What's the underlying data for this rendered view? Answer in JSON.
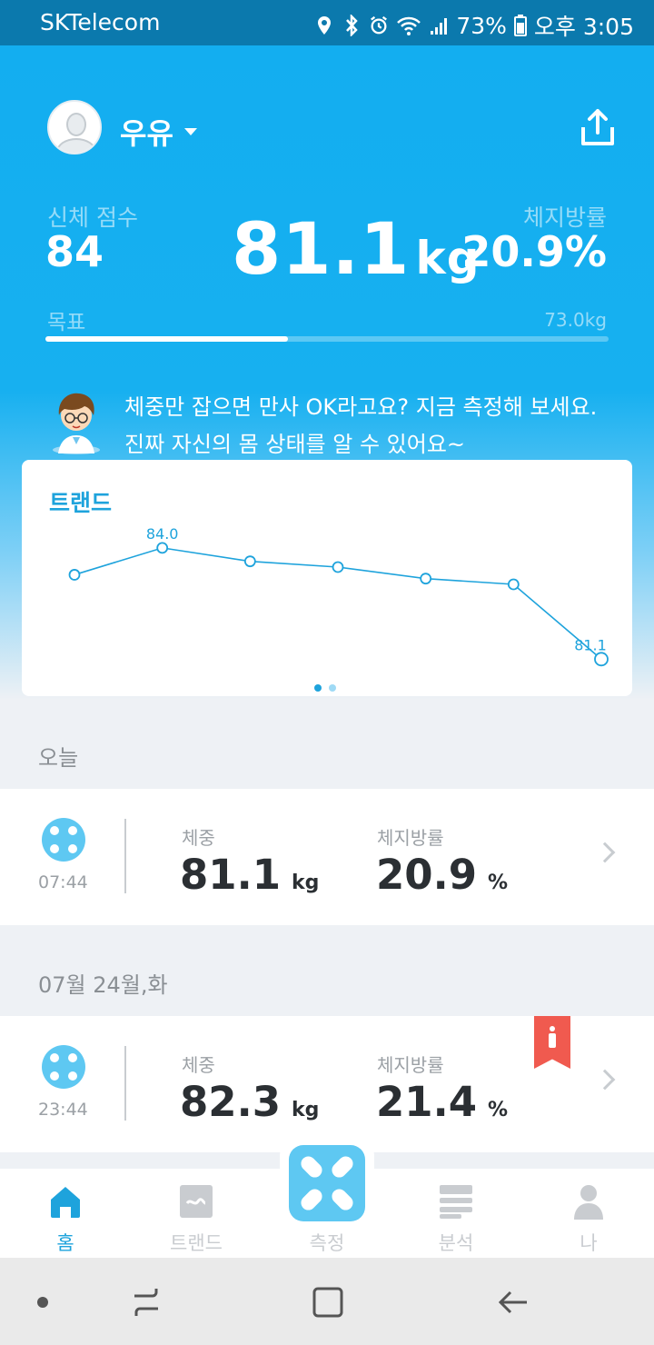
{
  "status_bar": {
    "carrier": "SKTelecom",
    "battery": "73%",
    "time": "오후 3:05"
  },
  "header": {
    "username": "우유",
    "score_label": "신체 점수",
    "score_value": "84",
    "weight_value": "81.1",
    "weight_unit": "kg",
    "fat_label": "체지방률",
    "fat_value": "20.9%",
    "goal_label": "목표",
    "goal_value": "73.0kg",
    "goal_progress_percent": 43
  },
  "tip": {
    "text": "체중만 잡으면 만사 OK라고요? 지금 측정해 보세요. 진짜 자신의 몸 상태를 알 수 있어요~"
  },
  "trend": {
    "title": "트랜드",
    "page_count": 2,
    "active_page": 0
  },
  "chart_data": {
    "type": "line",
    "title": "트랜드",
    "series": [
      {
        "values": [
          83.3,
          84.0,
          83.65,
          83.5,
          83.2,
          83.05,
          81.1
        ]
      }
    ],
    "data_labels": [
      {
        "index": 1,
        "text": "84.0"
      },
      {
        "index": 6,
        "text": "81.1"
      }
    ],
    "ylim": [
      80.8,
      84.4
    ],
    "grid": false,
    "color": "#1ea3dc"
  },
  "today": {
    "section_label": "오늘",
    "time": "07:44",
    "weight_label": "체중",
    "weight_value": "81.1",
    "weight_unit": "kg",
    "fat_label": "체지방률",
    "fat_value": "20.9",
    "fat_unit": "%"
  },
  "previous": {
    "section_label": "07월 24월,화",
    "time": "23:44",
    "weight_label": "체중",
    "weight_value": "82.3",
    "weight_unit": "kg",
    "fat_label": "체지방률",
    "fat_value": "21.4",
    "fat_unit": "%"
  },
  "bottom_nav": {
    "home": "홈",
    "trend": "트랜드",
    "measure": "측정",
    "analysis": "분석",
    "me": "나"
  },
  "colors": {
    "accent": "#1ea3dc",
    "header_blue": "#13aef0",
    "status_bar": "#0b79ad",
    "flag_red": "#f05a4f"
  }
}
